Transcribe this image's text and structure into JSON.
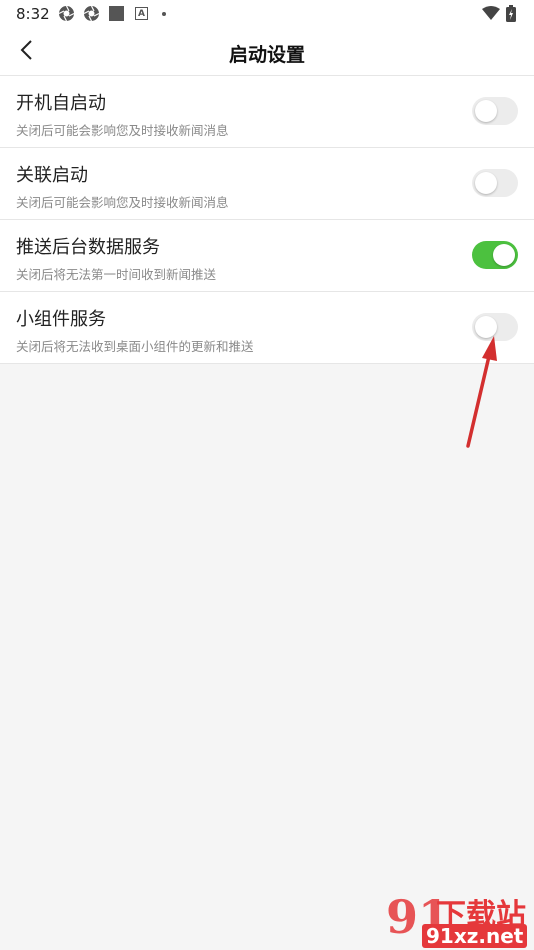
{
  "statusbar": {
    "time": "8:32",
    "icons": [
      "aperture-icon",
      "aperture-icon",
      "square-icon",
      "a-icon",
      "dot-icon"
    ],
    "right_icons": [
      "wifi-icon",
      "battery-icon"
    ]
  },
  "header": {
    "title": "启动设置",
    "back_icon": "chevron-left-icon"
  },
  "settings": [
    {
      "title": "开机自启动",
      "desc": "关闭后可能会影响您及时接收新闻消息",
      "enabled": false
    },
    {
      "title": "关联启动",
      "desc": "关闭后可能会影响您及时接收新闻消息",
      "enabled": false
    },
    {
      "title": "推送后台数据服务",
      "desc": "关闭后将无法第一时间收到新闻推送",
      "enabled": true
    },
    {
      "title": "小组件服务",
      "desc": "关闭后将无法收到桌面小组件的更新和推送",
      "enabled": false
    }
  ],
  "colors": {
    "toggle_on": "#4cc13f",
    "toggle_off": "#ececec",
    "annotation_arrow": "#d32f2f"
  },
  "watermark": {
    "logo_number": "91",
    "text": "下载站",
    "url": "91xz.net"
  }
}
